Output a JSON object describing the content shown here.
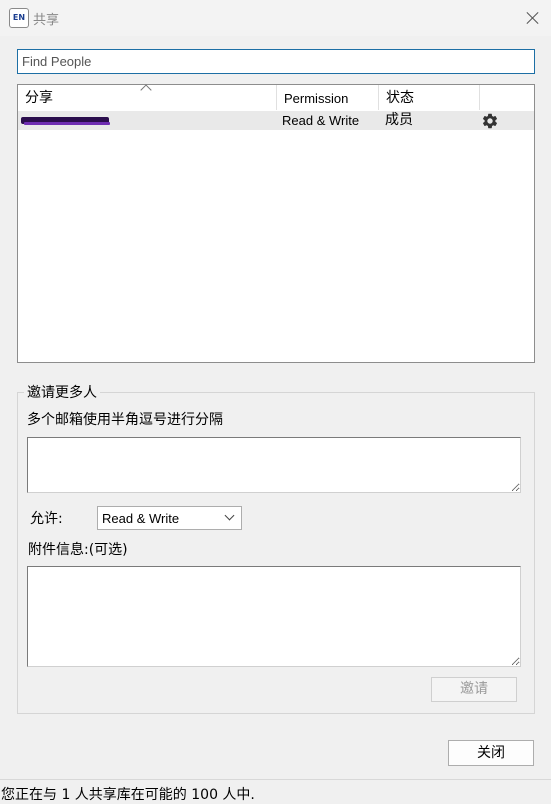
{
  "window": {
    "title": "共享",
    "app_icon_label": "EN"
  },
  "search": {
    "value": "Find People"
  },
  "table": {
    "columns": [
      "分享",
      "Permission",
      "状态",
      ""
    ],
    "rows": [
      {
        "name": "[redacted]",
        "permission": "Read & Write",
        "status": "成员",
        "action_icon": "gear-icon"
      }
    ]
  },
  "invite": {
    "group_title": "邀请更多人",
    "hint": "多个邮箱使用半角逗号进行分隔",
    "allow_label": "允许:",
    "permission_selected": "Read & Write",
    "attachment_label": "附件信息:(可选)",
    "invite_button": "邀请"
  },
  "footer": {
    "close_button": "关闭",
    "status_text": "您正在与 1 人共享库在可能的 100 人中."
  }
}
